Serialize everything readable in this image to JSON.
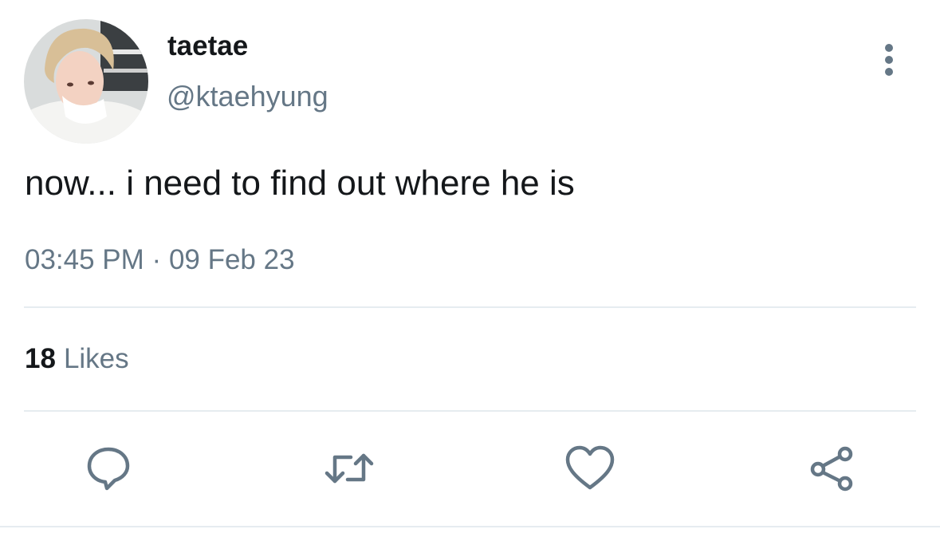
{
  "author": {
    "display_name": "taetae",
    "handle": "@ktaehyung"
  },
  "tweet": {
    "text": "now... i need to find out where he is",
    "time": "03:45 PM",
    "separator": "·",
    "date": "09 Feb 23"
  },
  "stats": {
    "likes_count": "18",
    "likes_label": "Likes"
  },
  "icons": {
    "more": "more-vertical-icon",
    "reply": "reply-icon",
    "retweet": "retweet-icon",
    "like": "heart-icon",
    "share": "share-icon"
  },
  "colors": {
    "text_primary": "#14171a",
    "text_secondary": "#657786",
    "divider": "#e6ecf0"
  }
}
